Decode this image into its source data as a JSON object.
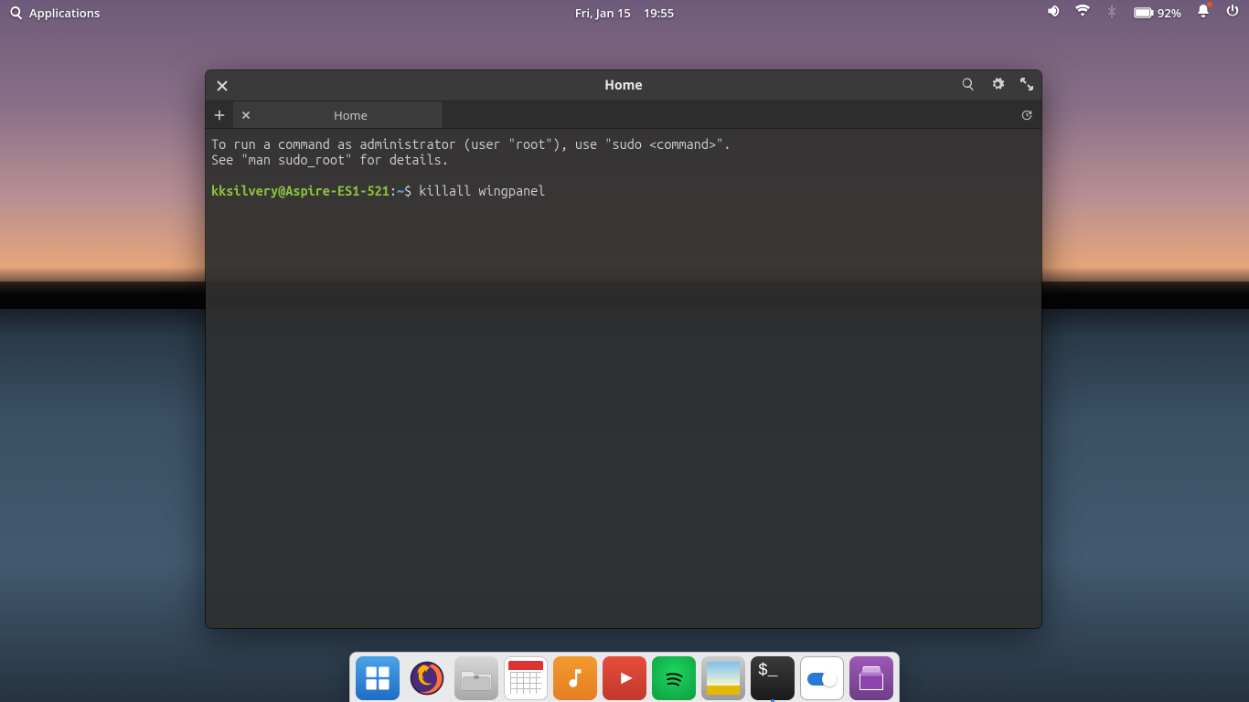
{
  "panel": {
    "apps_label": "Applications",
    "date": "Fri, Jan 15",
    "time": "19:55",
    "battery_pct": "92%"
  },
  "window": {
    "title": "Home",
    "tab_label": "Home",
    "terminal": {
      "line1": "To run a command as administrator (user \"root\"), use \"sudo <command>\".",
      "line2": "See \"man sudo_root\" for details.",
      "prompt_userhost": "kksilvery@Aspire-ES1-521",
      "prompt_sep": ":",
      "prompt_path": "~",
      "prompt_sigil": "$",
      "command": "killall wingpanel"
    }
  },
  "dock": {
    "items": [
      {
        "name": "multitasking"
      },
      {
        "name": "firefox"
      },
      {
        "name": "files"
      },
      {
        "name": "calendar"
      },
      {
        "name": "music"
      },
      {
        "name": "youtube"
      },
      {
        "name": "spotify"
      },
      {
        "name": "photos"
      },
      {
        "name": "terminal"
      },
      {
        "name": "system-settings"
      },
      {
        "name": "appcenter"
      }
    ]
  }
}
